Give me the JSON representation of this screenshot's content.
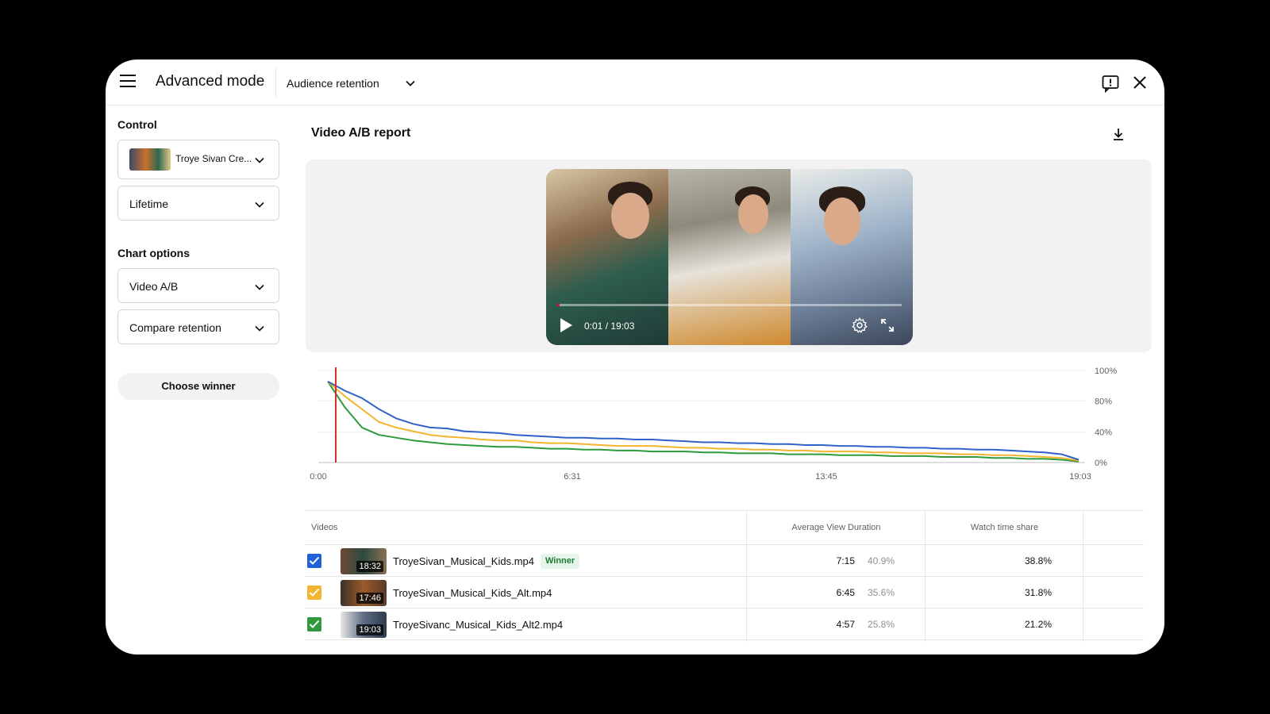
{
  "header": {
    "title": "Advanced mode",
    "report_select": "Audience retention"
  },
  "sidebar": {
    "control_label": "Control",
    "control_video": "Troye Sivan Cre...",
    "period": "Lifetime",
    "chart_options_label": "Chart options",
    "chart_type": "Video A/B",
    "compare_metric": "Compare retention",
    "choose_winner": "Choose winner"
  },
  "main": {
    "title": "Video A/B report"
  },
  "player": {
    "timecode": "0:01 / 19:03",
    "progress": 0.001
  },
  "chart_data": {
    "type": "line",
    "x_ticks": [
      "0:00",
      "6:31",
      "13:45",
      "19:03"
    ],
    "y_ticks": [
      "100%",
      "80%",
      "40%",
      "0%"
    ],
    "ylim": [
      0,
      100
    ],
    "marker_x": 0.01,
    "grid": true,
    "series": [
      {
        "color": "#2e62c9",
        "values": [
          88,
          78,
          70,
          58,
          48,
          42,
          38,
          37,
          34,
          33,
          32,
          30,
          29,
          28,
          27,
          27,
          26,
          26,
          25,
          25,
          24,
          23,
          22,
          22,
          21,
          21,
          20,
          20,
          19,
          19,
          18,
          18,
          17,
          17,
          16,
          16,
          15,
          15,
          14,
          14,
          13,
          12,
          11,
          9,
          3
        ]
      },
      {
        "color": "#f2b530",
        "values": [
          88,
          72,
          58,
          44,
          38,
          34,
          30,
          28,
          27,
          25,
          24,
          24,
          22,
          21,
          21,
          20,
          19,
          18,
          18,
          18,
          17,
          16,
          16,
          15,
          15,
          14,
          14,
          13,
          13,
          12,
          12,
          12,
          11,
          11,
          10,
          10,
          10,
          9,
          9,
          8,
          8,
          7,
          6,
          5,
          2
        ]
      },
      {
        "color": "#2e9a3d",
        "values": [
          88,
          60,
          38,
          30,
          27,
          24,
          22,
          20,
          19,
          18,
          17,
          17,
          16,
          15,
          15,
          14,
          14,
          13,
          13,
          12,
          12,
          12,
          11,
          11,
          10,
          10,
          10,
          9,
          9,
          9,
          8,
          8,
          8,
          7,
          7,
          7,
          6,
          6,
          6,
          5,
          5,
          4,
          4,
          3,
          1
        ]
      }
    ]
  },
  "table": {
    "columns": [
      "Videos",
      "Average View Duration",
      "Watch time share"
    ],
    "rows": [
      {
        "color": "#1f62d6",
        "duration": "18:32",
        "name": "TroyeSivan_Musical_Kids.mp4",
        "badge": "Winner",
        "avd": "7:15",
        "avd_pct": "40.9%",
        "share": "38.8%"
      },
      {
        "color": "#f2b530",
        "duration": "17:46",
        "name": "TroyeSivan_Musical_Kids_Alt.mp4",
        "badge": "",
        "avd": "6:45",
        "avd_pct": "35.6%",
        "share": "31.8%"
      },
      {
        "color": "#2e9a3d",
        "duration": "19:03",
        "name": "TroyeSivanc_Musical_Kids_Alt2.mp4",
        "badge": "",
        "avd": "4:57",
        "avd_pct": "25.8%",
        "share": "21.2%"
      }
    ]
  }
}
